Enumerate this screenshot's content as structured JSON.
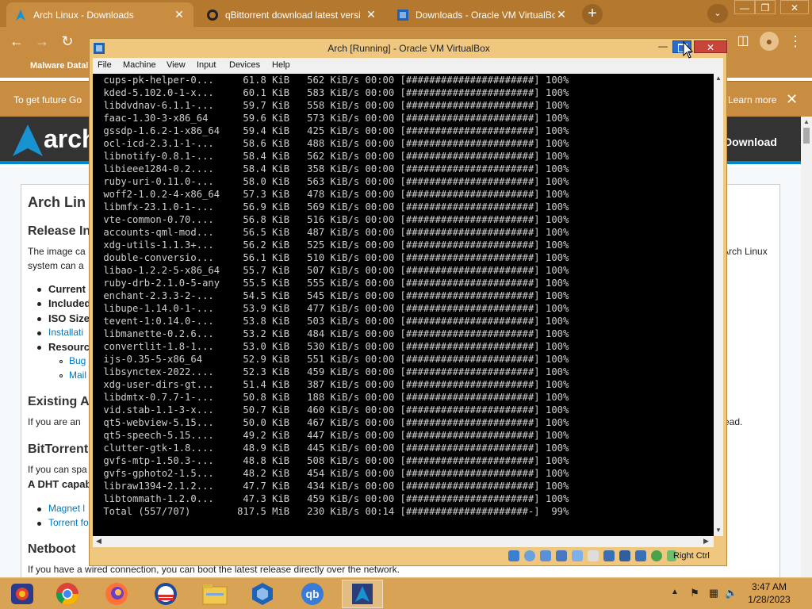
{
  "browser": {
    "tabs": [
      {
        "title": "Arch Linux - Downloads",
        "icon": "arch-icon",
        "close": "✕"
      },
      {
        "title": "qBittorrent download latest versi",
        "icon": "github-icon",
        "close": "✕"
      },
      {
        "title": "Downloads - Oracle VM VirtualBox",
        "icon": "virtualbox-icon",
        "close": "✕"
      }
    ],
    "new_tab": "+",
    "tab_search": "⌄",
    "window_controls": {
      "minimize": "—",
      "restore": "❐",
      "close": "✕"
    },
    "nav": {
      "back": "←",
      "forward": "→",
      "reload": "↻"
    },
    "bookmark": "Malware Datal",
    "infobar": {
      "text": "To get future Go",
      "link": "Learn more",
      "close": "✕"
    },
    "toolbar_icons": {
      "sidebar": "◫",
      "profile": "●",
      "menu": "⋮"
    }
  },
  "arch_page": {
    "logo": "arch",
    "download": "Download",
    "title": "Arch Lin",
    "release_heading": "Release In",
    "intro_1": "The image ca",
    "intro_1_right": "Arch Linux",
    "intro_2": "system can a",
    "bullets": [
      "Current",
      "Included",
      "ISO Size",
      "Installati",
      "Resourc"
    ],
    "sub_bullets": [
      "Bug",
      "Mail"
    ],
    "existing_heading": "Existing A",
    "existing_text": "If you are an",
    "existing_right": "ead.",
    "bittorrent_heading": "BitTorrent",
    "bittorrent_text": "If you can spa",
    "dht_text": "A DHT capab",
    "magnet": "Magnet l",
    "torrent": "Torrent fo",
    "netboot_heading": "Netboot",
    "netboot_text": "If you have a wired connection, you can boot the latest release directly over the network."
  },
  "vbox": {
    "title": "Arch [Running] - Oracle VM VirtualBox",
    "minimize": "—",
    "close": "✕",
    "menu": [
      "File",
      "Machine",
      "View",
      "Input",
      "Devices",
      "Help"
    ],
    "host_key": "Right Ctrl",
    "terminal_lines": [
      " cups-pk-helper-0...     61.8 KiB   562 KiB/s 00:00 [######################] 100%",
      " kded-5.102.0-1-x...     60.1 KiB   583 KiB/s 00:00 [######################] 100%",
      " libdvdnav-6.1.1-...     59.7 KiB   558 KiB/s 00:00 [######################] 100%",
      " faac-1.30-3-x86_64      59.6 KiB   573 KiB/s 00:00 [######################] 100%",
      " gssdp-1.6.2-1-x86_64    59.4 KiB   425 KiB/s 00:00 [######################] 100%",
      " ocl-icd-2.3.1-1-...     58.6 KiB   488 KiB/s 00:00 [######################] 100%",
      " libnotify-0.8.1-...     58.4 KiB   562 KiB/s 00:00 [######################] 100%",
      " libieee1284-0.2....     58.4 KiB   358 KiB/s 00:00 [######################] 100%",
      " ruby-uri-0.11.0-...     58.0 KiB   563 KiB/s 00:00 [######################] 100%",
      " woff2-1.0.2-4-x86_64    57.3 KiB   478 KiB/s 00:00 [######################] 100%",
      " libmfx-23.1.0-1-...     56.9 KiB   569 KiB/s 00:00 [######################] 100%",
      " vte-common-0.70....     56.8 KiB   516 KiB/s 00:00 [######################] 100%",
      " accounts-qml-mod...     56.5 KiB   487 KiB/s 00:00 [######################] 100%",
      " xdg-utils-1.1.3+...     56.2 KiB   525 KiB/s 00:00 [######################] 100%",
      " double-conversio...     56.1 KiB   510 KiB/s 00:00 [######################] 100%",
      " libao-1.2.2-5-x86_64    55.7 KiB   507 KiB/s 00:00 [######################] 100%",
      " ruby-drb-2.1.0-5-any    55.5 KiB   555 KiB/s 00:00 [######################] 100%",
      " enchant-2.3.3-2-...     54.5 KiB   545 KiB/s 00:00 [######################] 100%",
      " libupe-1.14.0-1-...     53.9 KiB   477 KiB/s 00:00 [######################] 100%",
      " tevent-1:0.14.0-...     53.8 KiB   503 KiB/s 00:00 [######################] 100%",
      " libmanette-0.2.6...     53.2 KiB   484 KiB/s 00:00 [######################] 100%",
      " convertlit-1.8-1...     53.0 KiB   530 KiB/s 00:00 [######################] 100%",
      " ijs-0.35-5-x86_64       52.9 KiB   551 KiB/s 00:00 [######################] 100%",
      " libsynctex-2022....     52.3 KiB   459 KiB/s 00:00 [######################] 100%",
      " xdg-user-dirs-gt...     51.4 KiB   387 KiB/s 00:00 [######################] 100%",
      " libdmtx-0.7.7-1-...     50.8 KiB   188 KiB/s 00:00 [######################] 100%",
      " vid.stab-1.1-3-x...     50.7 KiB   460 KiB/s 00:00 [######################] 100%",
      " qt5-webview-5.15...     50.0 KiB   467 KiB/s 00:00 [######################] 100%",
      " qt5-speech-5.15....     49.2 KiB   447 KiB/s 00:00 [######################] 100%",
      " clutter-gtk-1.8....     48.9 KiB   445 KiB/s 00:00 [######################] 100%",
      " gvfs-mtp-1.50.3-...     48.8 KiB   508 KiB/s 00:00 [######################] 100%",
      " gvfs-gphoto2-1.5...     48.2 KiB   454 KiB/s 00:00 [######################] 100%",
      " libraw1394-2.1.2...     47.7 KiB   434 KiB/s 00:00 [######################] 100%",
      " libtommath-1.2.0...     47.3 KiB   459 KiB/s 00:00 [######################] 100%",
      " Total (557/707)        817.5 MiB   230 KiB/s 00:14 [#####################-]  99%"
    ]
  },
  "taskbar": {
    "apps": [
      "start-icon",
      "chrome-icon",
      "firefox-icon",
      "obama-icon",
      "file-explorer-icon",
      "virtualbox-icon",
      "qbittorrent-icon",
      "arch-vm-icon"
    ],
    "qb_label": "qb",
    "tray_arrow": "▲",
    "time": "3:47 AM",
    "date": "1/28/2023"
  },
  "colors": {
    "tab_bar": "#b5782f",
    "toolbar": "#c98d42",
    "vbox_frame": "#f0c77e",
    "taskbar": "#d9a355",
    "arch_blue": "#1793d1"
  }
}
